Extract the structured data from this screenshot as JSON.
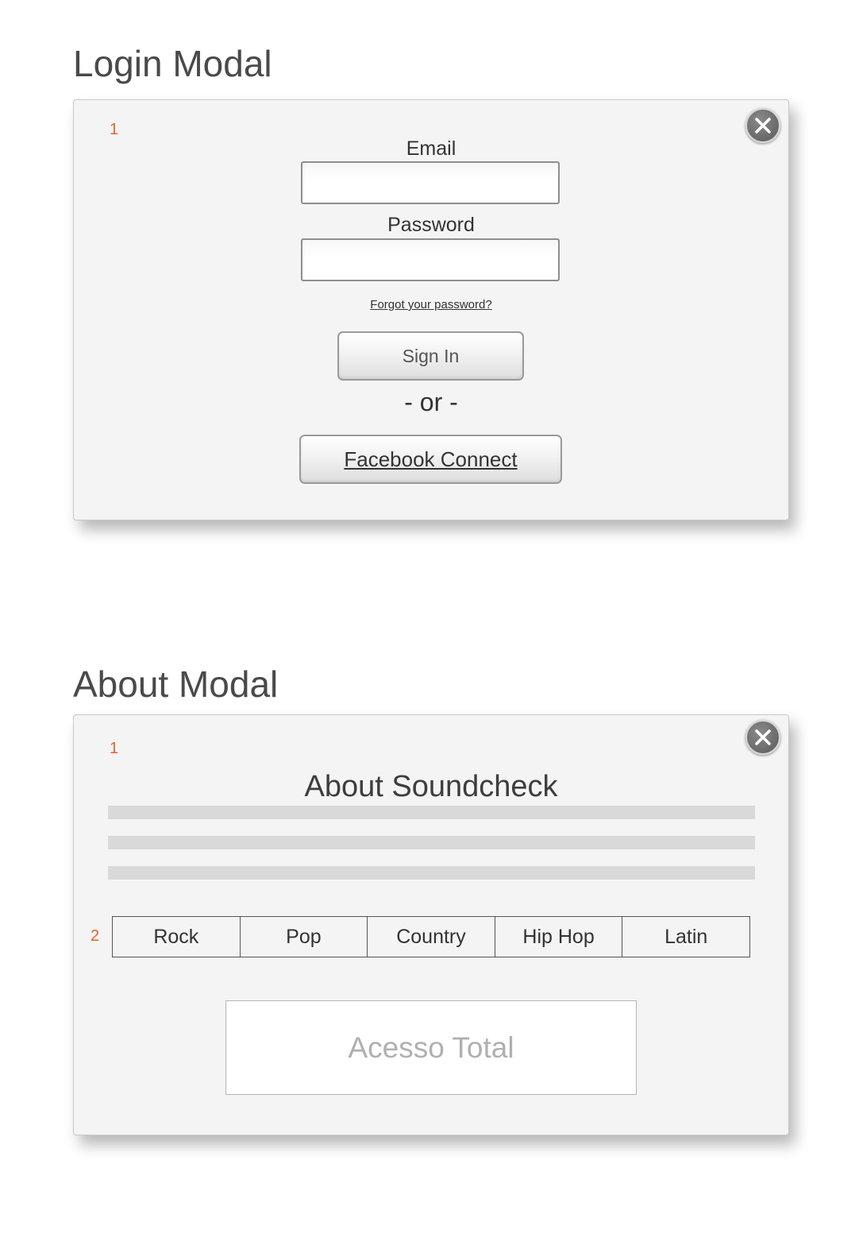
{
  "login_section": {
    "title": "Login Modal",
    "annotation": "1",
    "email_label": "Email",
    "email_value": "",
    "password_label": "Password",
    "password_value": "",
    "forgot_link": "Forgot your password?",
    "sign_in_label": "Sign In",
    "or_separator": "- or -",
    "facebook_label": "Facebook Connect",
    "close_icon": "close-icon"
  },
  "about_section": {
    "title": "About Modal",
    "annotation_1": "1",
    "annotation_2": "2",
    "heading": "About Soundcheck",
    "genres": [
      "Rock",
      "Pop",
      "Country",
      "Hip Hop",
      "Latin"
    ],
    "promo_label": "Acesso Total",
    "close_icon": "close-icon"
  },
  "colors": {
    "annotation": "#e8622a",
    "modal_bg": "#f4f4f4",
    "placeholder_bar": "#d9d9d9",
    "close_button": "#6a6a6a"
  }
}
